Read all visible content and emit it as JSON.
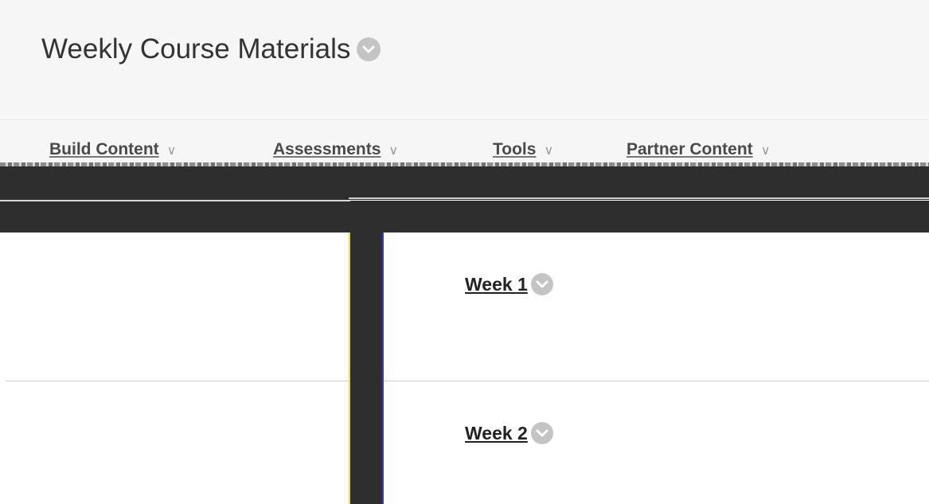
{
  "header": {
    "title": "Weekly Course Materials",
    "title_menu_icon": "circle-chevron-down-icon"
  },
  "toolbar": {
    "items": [
      {
        "label": "Build Content",
        "icon": "chevron-down-icon"
      },
      {
        "label": "Assessments",
        "icon": "chevron-down-icon"
      },
      {
        "label": "Tools",
        "icon": "chevron-down-icon"
      },
      {
        "label": "Partner Content",
        "icon": "chevron-down-icon"
      }
    ]
  },
  "content": {
    "items": [
      {
        "label": "Week 1",
        "menu_icon": "circle-chevron-down-icon"
      },
      {
        "label": "Week 2",
        "menu_icon": "circle-chevron-down-icon"
      }
    ]
  },
  "colors": {
    "header_bg": "#f6f6f6",
    "dark_band": "#2e2e2e",
    "link_text": "#222222",
    "chevron_circle": "#c4c4c4"
  }
}
